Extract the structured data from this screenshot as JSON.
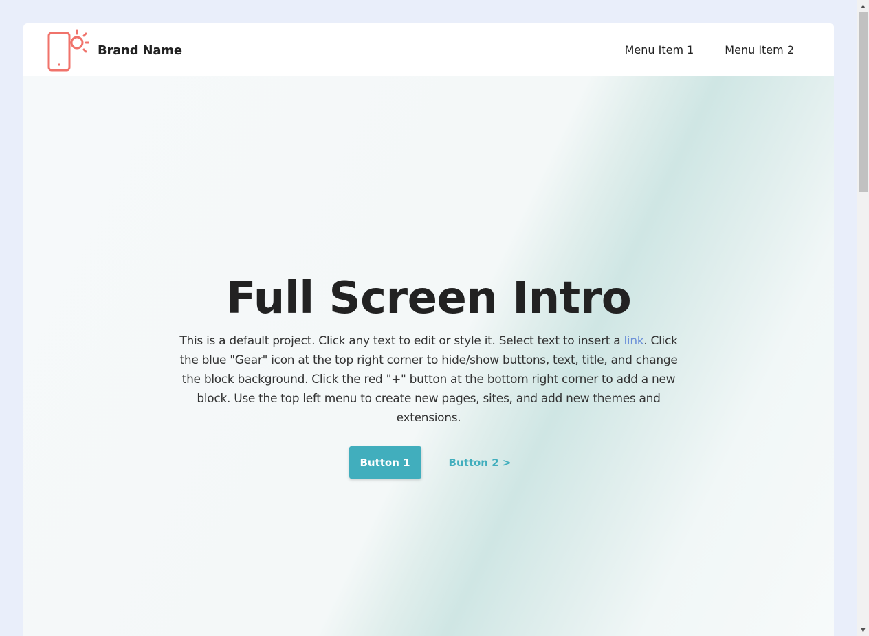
{
  "navbar": {
    "brand_name": "Brand Name",
    "logo_icon": "phone-sun-icon",
    "menu": [
      {
        "label": "Menu Item 1"
      },
      {
        "label": "Menu Item 2"
      }
    ]
  },
  "hero": {
    "title": "Full Screen Intro",
    "text_before_link": "This is a default project. Click any text to edit or style it. Select text to insert a ",
    "link_text": "link",
    "text_after_link": ". Click the blue \"Gear\" icon at the top right corner to hide/show buttons, text, title, and change the block background. Click the red \"+\" button at the bottom right corner to add a new block. Use the top left menu to create new pages, sites, and add new themes and extensions.",
    "button_primary": "Button 1",
    "button_secondary": "Button 2 >"
  },
  "colors": {
    "accent": "#41aebd",
    "logo": "#f0736b",
    "link": "#6a8fd8",
    "page_bg": "#e9eefa"
  }
}
